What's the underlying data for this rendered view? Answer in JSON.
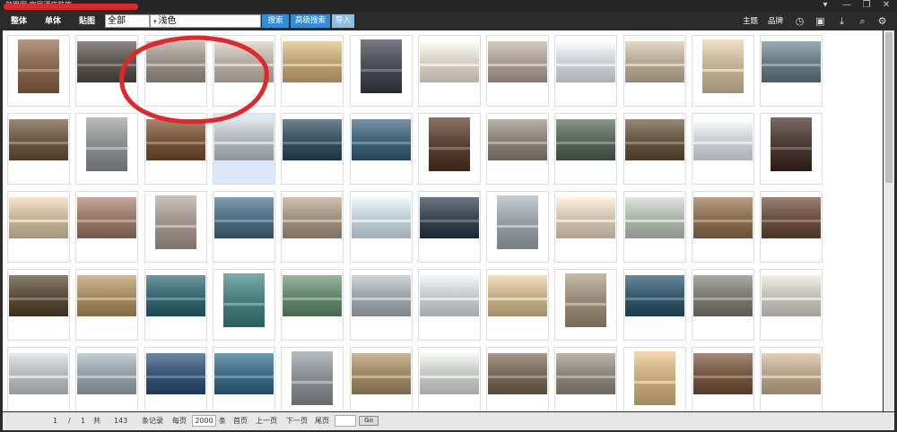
{
  "window": {
    "title": "效果图·家居酒店装饰",
    "controls": [
      "▾",
      "—",
      "❐",
      "✕"
    ]
  },
  "toolbar": {
    "tabs": [
      "整体",
      "单体",
      "贴图"
    ],
    "category_selected": "全部",
    "search_value": "浅色",
    "search_button": "搜索",
    "advanced_button": "高级搜索",
    "import_button": "导入",
    "right_links": [
      "主题",
      "品牌"
    ],
    "icons": [
      "clock-icon",
      "image-icon",
      "download-icon",
      "search-icon",
      "gear-icon"
    ]
  },
  "palette": {
    "accent": "#2f8fd8",
    "accent_light": "#8fbedf",
    "annotation": "#e0282c"
  },
  "grid": {
    "columns": 12,
    "rows": 5,
    "selected_index": 15,
    "tones": [
      [
        "#8a6a52",
        "#5f5a55",
        "#9a938c",
        "#b8b0a6",
        "#c0a47a",
        "#4c4f57",
        "#d8d2c8",
        "#a99f94",
        "#cfd3d8",
        "#b8ab98",
        "#c6b49a",
        "#6d7f86"
      ],
      [
        "#6f5d4a",
        "#8e8f90",
        "#7b5a42",
        "#b3b8bc",
        "#3f5664",
        "#47687b",
        "#5d4537",
        "#8d847a",
        "#5c6a60",
        "#6a5a48",
        "#cfd2d6",
        "#4e3d3a"
      ],
      [
        "#c9b7a0",
        "#9a7c6c",
        "#a0968d",
        "#557184",
        "#a39483",
        "#c2d0d8",
        "#3e4a56",
        "#9aa0a6",
        "#d3c7b3",
        "#b0b8b0",
        "#8d7358",
        "#6e5546"
      ],
      [
        "#5d5140",
        "#a88d66",
        "#3f6b74",
        "#4d8180",
        "#6a8a72",
        "#a2a8ac",
        "#c9cccf",
        "#c9b28e",
        "#9a8d7a",
        "#3c5d6e",
        "#7e7d78",
        "#c5c3bb"
      ],
      [
        "#b9bcbf",
        "#98a3a8",
        "#3d5b78",
        "#427089",
        "#8b8f93",
        "#a08b6a",
        "#c9cbc8",
        "#7a6d5e",
        "#8f8a80",
        "#c8ab80",
        "#7a5c4a",
        "#b8a58c"
      ]
    ]
  },
  "status": {
    "current_page": "1",
    "separator": "/",
    "total_pages": "1",
    "gong": "共",
    "total_records": "143",
    "records_label": "条记录",
    "per_page_label": "每页",
    "per_page_value": "2000",
    "tiao": "条",
    "first": "首页",
    "prev": "上一页",
    "next": "下一页",
    "last": "尾页",
    "go": "Go"
  }
}
